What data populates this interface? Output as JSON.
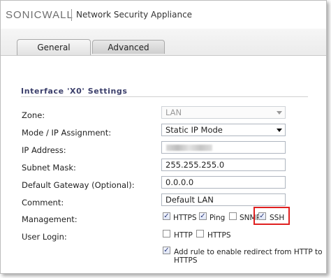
{
  "header": {
    "brand": "SONICWALL",
    "app_title": "Network Security Appliance"
  },
  "tabs": [
    {
      "label": "General",
      "active": true
    },
    {
      "label": "Advanced",
      "active": false
    }
  ],
  "section": {
    "title": "Interface 'X0' Settings"
  },
  "form": {
    "zone": {
      "label": "Zone:",
      "value": "LAN",
      "disabled": true
    },
    "mode": {
      "label": "Mode / IP Assignment:",
      "value": "Static IP Mode"
    },
    "ip": {
      "label": "IP Address:"
    },
    "subnet": {
      "label": "Subnet Mask:",
      "value": "255.255.255.0"
    },
    "gateway": {
      "label": "Default Gateway (Optional):",
      "value": "0.0.0.0"
    },
    "comment": {
      "label": "Comment:",
      "value": "Default LAN"
    },
    "management": {
      "label": "Management:",
      "options": [
        {
          "label": "HTTPS",
          "checked": true
        },
        {
          "label": "Ping",
          "checked": true
        },
        {
          "label": "SNMP",
          "checked": false
        },
        {
          "label": "SSH",
          "checked": true
        }
      ]
    },
    "user_login": {
      "label": "User Login:",
      "options": [
        {
          "label": "HTTP",
          "checked": false
        },
        {
          "label": "HTTPS",
          "checked": false
        }
      ]
    },
    "redirect": {
      "label": "Add rule to enable redirect from HTTP to HTTPS",
      "checked": true
    }
  },
  "colors": {
    "highlight": "#e02020",
    "section_title": "#3b3f6b",
    "check": "#2a3a7a"
  }
}
